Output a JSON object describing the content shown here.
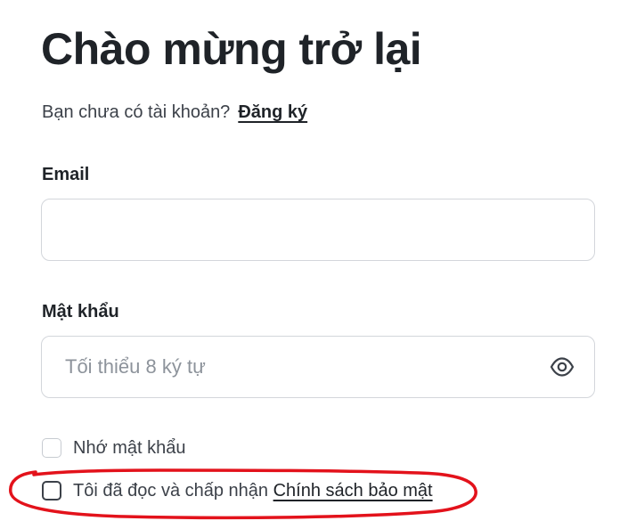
{
  "header": {
    "title": "Chào mừng trở lại"
  },
  "signup": {
    "prompt": "Bạn chưa có tài khoản?",
    "link_label": "Đăng ký"
  },
  "email": {
    "label": "Email",
    "value": "",
    "placeholder": ""
  },
  "password": {
    "label": "Mật khẩu",
    "value": "",
    "placeholder": "Tối thiểu 8 ký tự",
    "toggle_icon": "eye-icon"
  },
  "remember": {
    "label": "Nhớ mật khẩu",
    "checked": false
  },
  "terms": {
    "prefix": "Tôi đã đọc và chấp nhận",
    "link_label": "Chính sách bảo mật",
    "checked": false
  },
  "annotation": {
    "color": "#e3121b"
  }
}
